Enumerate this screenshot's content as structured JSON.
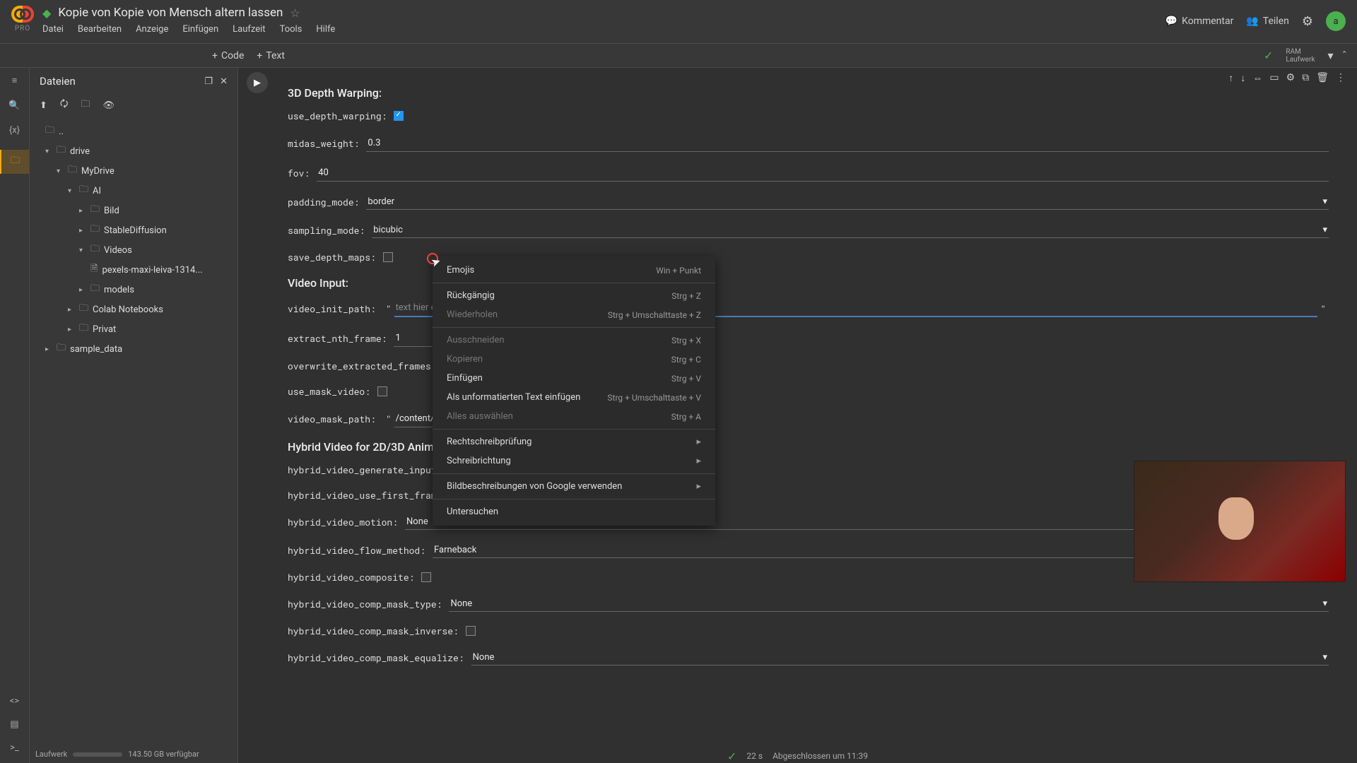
{
  "header": {
    "pro_label": "PRO",
    "title": "Kopie von Kopie von Mensch altern lassen",
    "menu": [
      "Datei",
      "Bearbeiten",
      "Anzeige",
      "Einfügen",
      "Laufzeit",
      "Tools",
      "Hilfe"
    ],
    "kommentar": "Kommentar",
    "teilen": "Teilen",
    "avatar": "a"
  },
  "toolbar": {
    "code": "Code",
    "text": "Text",
    "ram": "RAM",
    "laufwerk": "Laufwerk"
  },
  "file_panel": {
    "title": "Dateien",
    "footer_label": "Laufwerk",
    "footer_space": "143.50 GB verfügbar",
    "tree": {
      "dots": "..",
      "drive": "drive",
      "mydrive": "MyDrive",
      "ai": "AI",
      "bild": "Bild",
      "stable": "StableDiffusion",
      "videos": "Videos",
      "video_file": "pexels-maxi-leiva-1314...",
      "models": "models",
      "colab": "Colab Notebooks",
      "privat": "Privat",
      "sample": "sample_data"
    }
  },
  "form": {
    "sec1": "3D Depth Warping:",
    "use_depth_warping": "use_depth_warping:",
    "midas_weight_label": "midas_weight:",
    "midas_weight": "0.3",
    "fov_label": "fov:",
    "fov": "40",
    "padding_mode_label": "padding_mode:",
    "padding_mode": "border",
    "sampling_mode_label": "sampling_mode:",
    "sampling_mode": "bicubic",
    "save_depth_maps": "save_depth_maps:",
    "sec2": "Video Input:",
    "video_init_path_label": "video_init_path:",
    "video_init_placeholder": "text hier einfügen",
    "extract_nth_frame_label": "extract_nth_frame:",
    "extract_nth_frame": "1",
    "overwrite_extracted_frames": "overwrite_extracted_frames:",
    "use_mask_video": "use_mask_video:",
    "video_mask_path_label": "video_mask_path:",
    "video_mask_path": "/content/",
    "sec3": "Hybrid Video for 2D/3D Anima",
    "hybrid_generate_input": "hybrid_video_generate_input",
    "hybrid_use_first_frame": "hybrid_video_use_first_fram",
    "hybrid_motion_label": "hybrid_video_motion:",
    "hybrid_motion": "None",
    "hybrid_flow_label": "hybrid_video_flow_method:",
    "hybrid_flow": "Farneback",
    "hybrid_composite": "hybrid_video_composite:",
    "hybrid_mask_type_label": "hybrid_video_comp_mask_type:",
    "hybrid_mask_type": "None",
    "hybrid_mask_inverse": "hybrid_video_comp_mask_inverse:",
    "hybrid_mask_equalize_label": "hybrid_video_comp_mask_equalize:",
    "hybrid_mask_equalize": "None"
  },
  "context_menu": {
    "emojis": "Emojis",
    "emojis_sc": "Win + Punkt",
    "undo": "Rückgängig",
    "undo_sc": "Strg + Z",
    "redo": "Wiederholen",
    "redo_sc": "Strg + Umschalttaste + Z",
    "cut": "Ausschneiden",
    "cut_sc": "Strg + X",
    "copy": "Kopieren",
    "copy_sc": "Strg + C",
    "paste": "Einfügen",
    "paste_sc": "Strg + V",
    "paste_plain": "Als unformatierten Text einfügen",
    "paste_plain_sc": "Strg + Umschalttaste + V",
    "select_all": "Alles auswählen",
    "select_all_sc": "Strg + A",
    "spellcheck": "Rechtschreibprüfung",
    "direction": "Schreibrichtung",
    "img_desc": "Bildbeschreibungen von Google verwenden",
    "inspect": "Untersuchen"
  },
  "status": {
    "time": "22 s",
    "done": "Abgeschlossen um 11:39"
  }
}
